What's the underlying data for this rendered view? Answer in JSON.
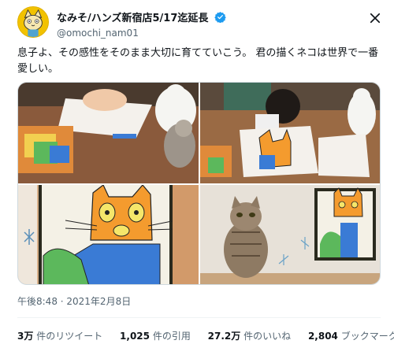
{
  "author": {
    "display_name": "なみそ/ハンズ新宿店5/17迄延長",
    "handle": "@omochi_nam01",
    "avatar_icon": "cat-avatar-icon",
    "verified_icon": "verified-badge-icon"
  },
  "tweet": {
    "text": "息子よ、その感性をそのまま大切に育てていこう。 君の描くネコは世界で一番愛しい。",
    "timestamp": "午後8:48 · 2021年2月8日"
  },
  "stats": [
    {
      "count": "3万",
      "label": "件のリツイート"
    },
    {
      "count": "1,025",
      "label": "件の引用"
    },
    {
      "count": "27.2万",
      "label": "件のいいね"
    },
    {
      "count": "2,804",
      "label": "ブックマーク"
    }
  ],
  "colors": {
    "verified_blue": "#1d9bf0",
    "text_primary": "#0f1419",
    "text_secondary": "#536471",
    "avatar_yellow": "#f2c200"
  }
}
